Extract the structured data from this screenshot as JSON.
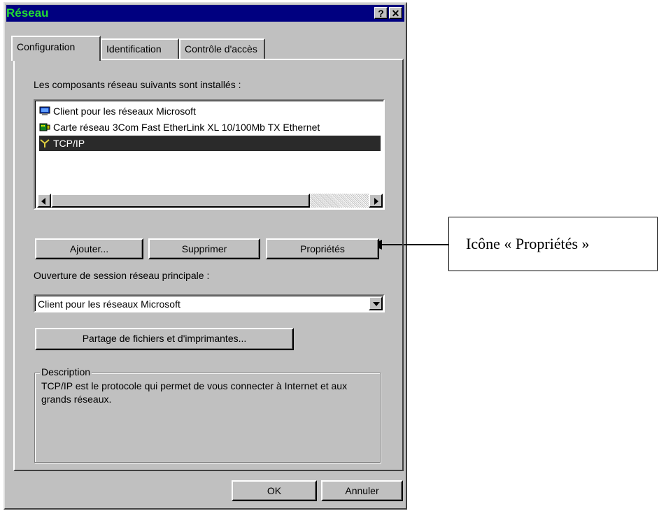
{
  "window": {
    "title": "Réseau",
    "help_button": "?",
    "close_button": "✕"
  },
  "tabs": [
    {
      "label": "Configuration",
      "active": true
    },
    {
      "label": "Identification",
      "active": false
    },
    {
      "label": "Contrôle d'accès",
      "active": false
    }
  ],
  "components": {
    "label": "Les composants réseau suivants sont installés :",
    "items": [
      {
        "label": "Client pour les réseaux Microsoft",
        "icon": "computer-icon",
        "selected": false
      },
      {
        "label": "Carte réseau 3Com Fast EtherLink XL 10/100Mb TX Ethernet",
        "icon": "network-card-icon",
        "selected": false
      },
      {
        "label": "TCP/IP",
        "icon": "protocol-icon",
        "selected": true
      }
    ]
  },
  "buttons": {
    "add": "Ajouter...",
    "remove": "Supprimer",
    "properties": "Propriétés",
    "file_sharing": "Partage de fichiers et d'imprimantes...",
    "ok": "OK",
    "cancel": "Annuler"
  },
  "logon": {
    "label": "Ouverture de session réseau principale :",
    "selected": "Client pour les réseaux Microsoft"
  },
  "description": {
    "legend": "Description",
    "text": "TCP/IP est le protocole qui permet de vous connecter à Internet et aux grands réseaux."
  },
  "callout": {
    "text": "Icône « Propriétés »"
  },
  "colors": {
    "titlebar": "#000080",
    "title_text": "#22dd33",
    "face": "#c0c0c0",
    "selection": "#2a2a2a"
  }
}
